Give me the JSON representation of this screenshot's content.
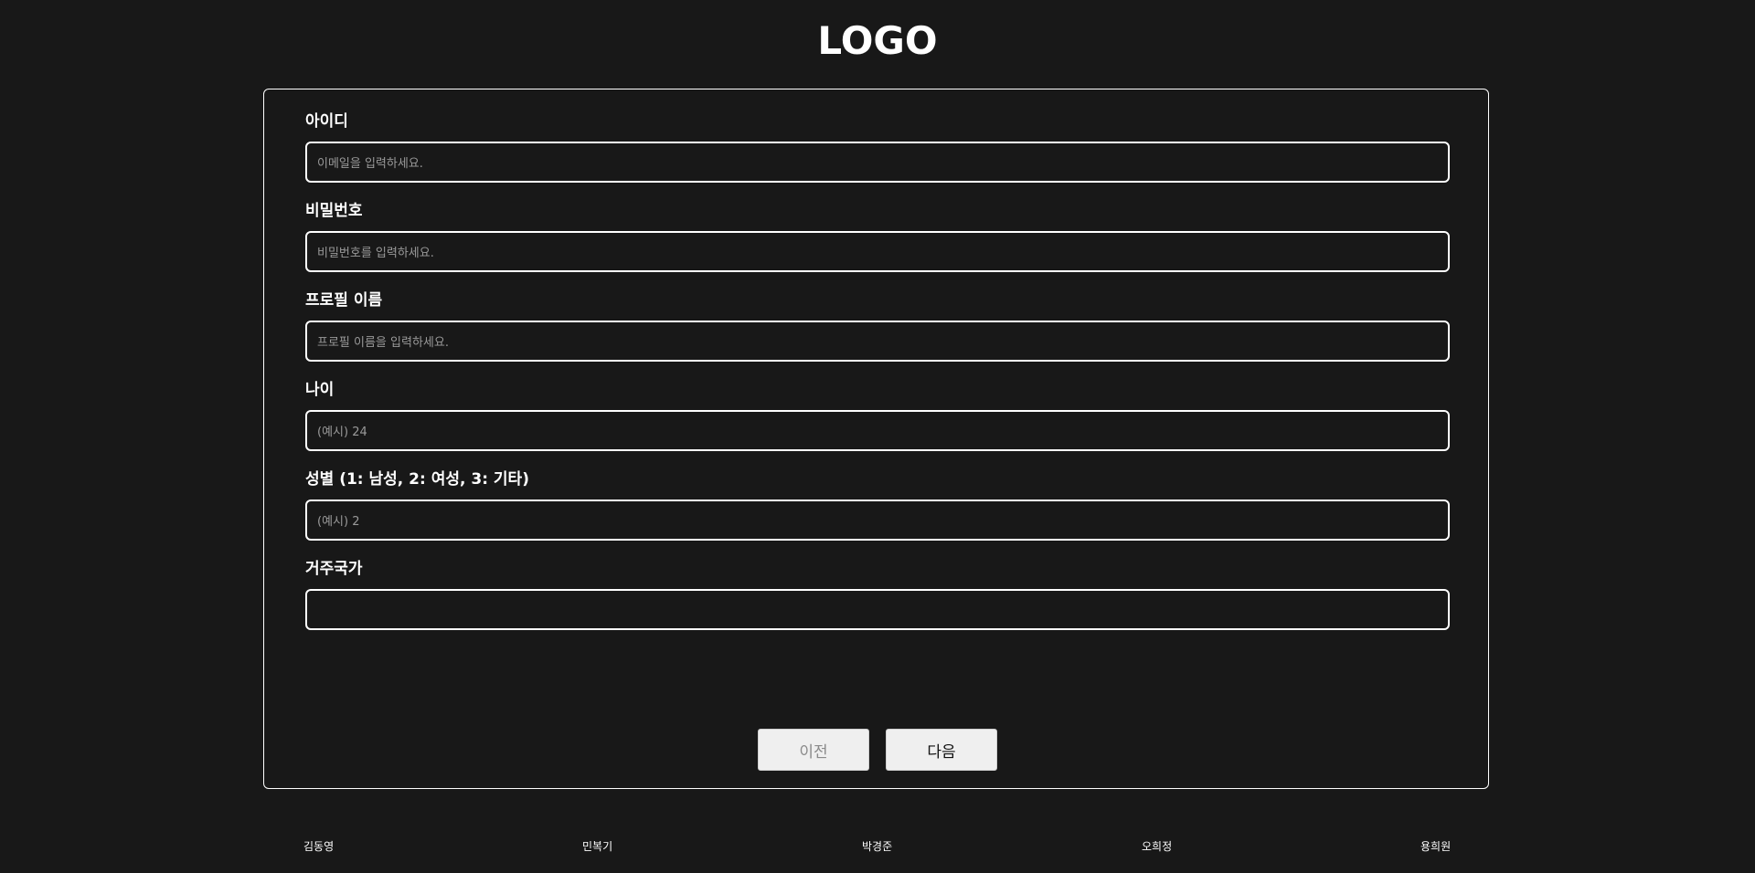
{
  "header": {
    "logo_text": "LOGO"
  },
  "form": {
    "fields": [
      {
        "label": "아이디",
        "placeholder": "이메일을 입력하세요.",
        "value": ""
      },
      {
        "label": "비밀번호",
        "placeholder": "비밀번호를 입력하세요.",
        "value": ""
      },
      {
        "label": "프로필 이름",
        "placeholder": "프로필 이름을 입력하세요.",
        "value": ""
      },
      {
        "label": "나이",
        "placeholder": "(예시) 24",
        "value": ""
      },
      {
        "label": "성별 (1: 남성, 2: 여성, 3: 기타)",
        "placeholder": "(예시) 2",
        "value": ""
      },
      {
        "label": "거주국가",
        "placeholder": "",
        "value": ""
      }
    ],
    "prev_label": "이전",
    "next_label": "다음"
  },
  "footer": {
    "names": [
      "김동영",
      "민복기",
      "박경준",
      "오희정",
      "용희원"
    ]
  },
  "colors": {
    "background": "#181818",
    "foreground": "#ffffff",
    "placeholder": "#9a9a9a",
    "button_bg": "#efefef",
    "prev_text": "#8a8a8a"
  }
}
